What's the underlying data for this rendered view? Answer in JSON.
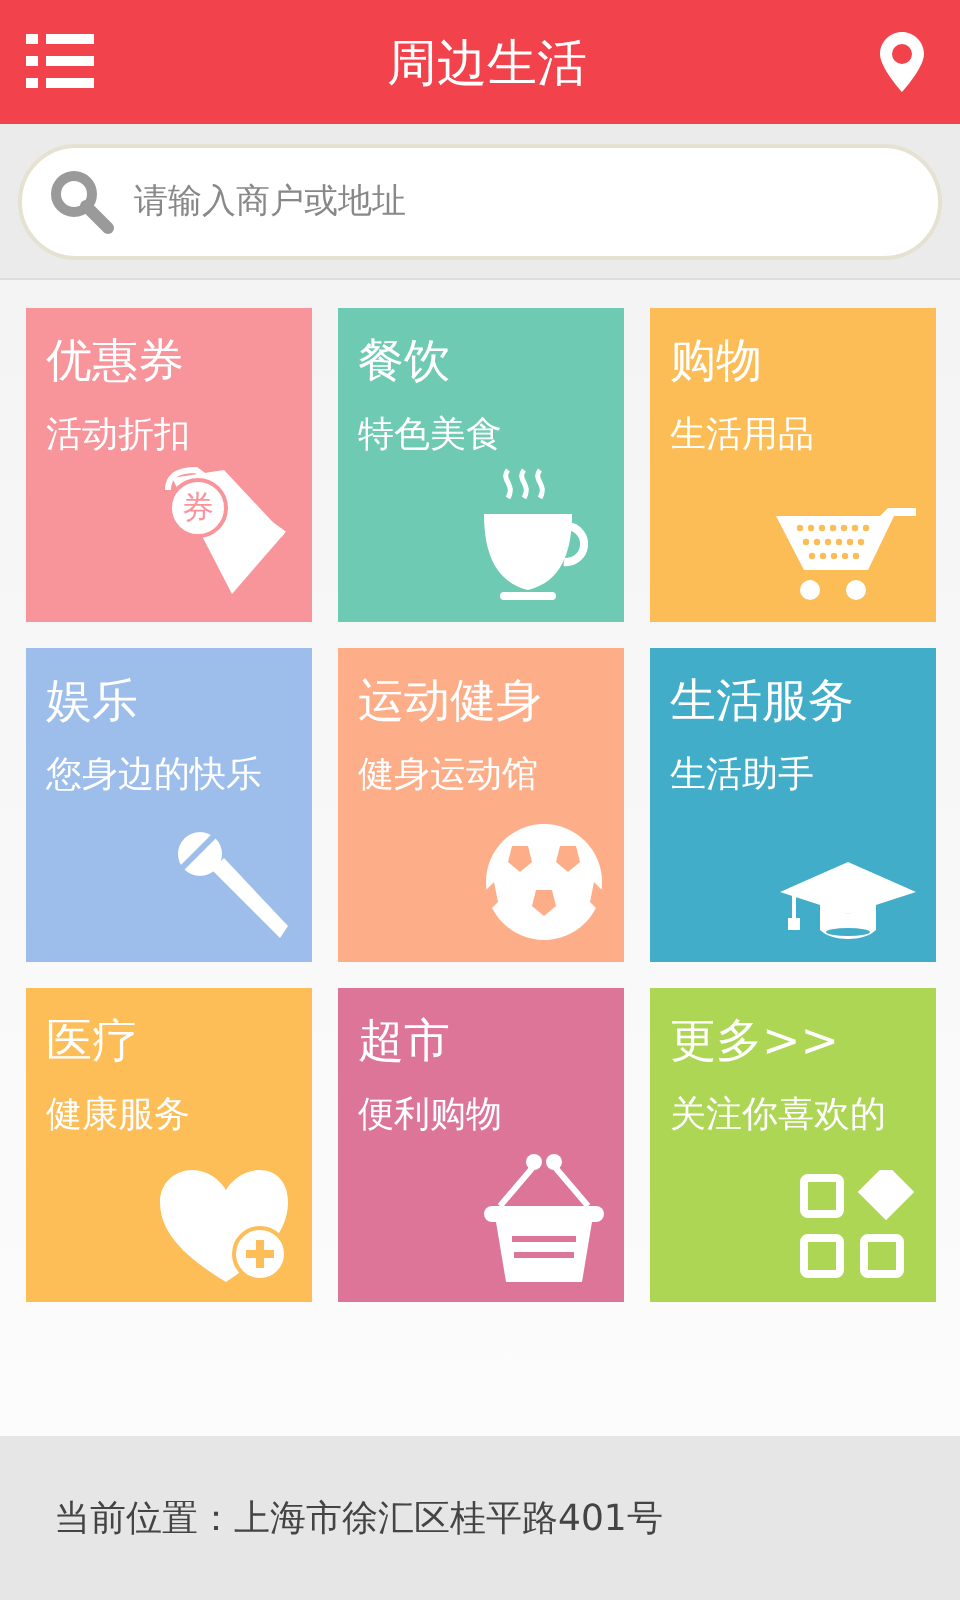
{
  "header": {
    "title": "周边生活"
  },
  "search": {
    "placeholder": "请输入商户或地址"
  },
  "tiles": [
    {
      "title": "优惠券",
      "subtitle": "活动折扣",
      "badge": "券",
      "color": "#f8959b"
    },
    {
      "title": "餐饮",
      "subtitle": "特色美食",
      "color": "#6ecab3"
    },
    {
      "title": "购物",
      "subtitle": "生活用品",
      "color": "#fcbd57"
    },
    {
      "title": "娱乐",
      "subtitle": "您身边的快乐",
      "color": "#9dbdeb"
    },
    {
      "title": "运动健身",
      "subtitle": "健身运动馆",
      "color": "#fdae88"
    },
    {
      "title": "生活服务",
      "subtitle": "生活助手",
      "color": "#41adc8"
    },
    {
      "title": "医疗",
      "subtitle": "健康服务",
      "color": "#fdbd57"
    },
    {
      "title": "超市",
      "subtitle": "便利购物",
      "color": "#dc7597"
    },
    {
      "title": "更多>>",
      "subtitle": "关注你喜欢的",
      "color": "#acd653"
    }
  ],
  "footer": {
    "location": "当前位置：上海市徐汇区桂平路401号"
  }
}
